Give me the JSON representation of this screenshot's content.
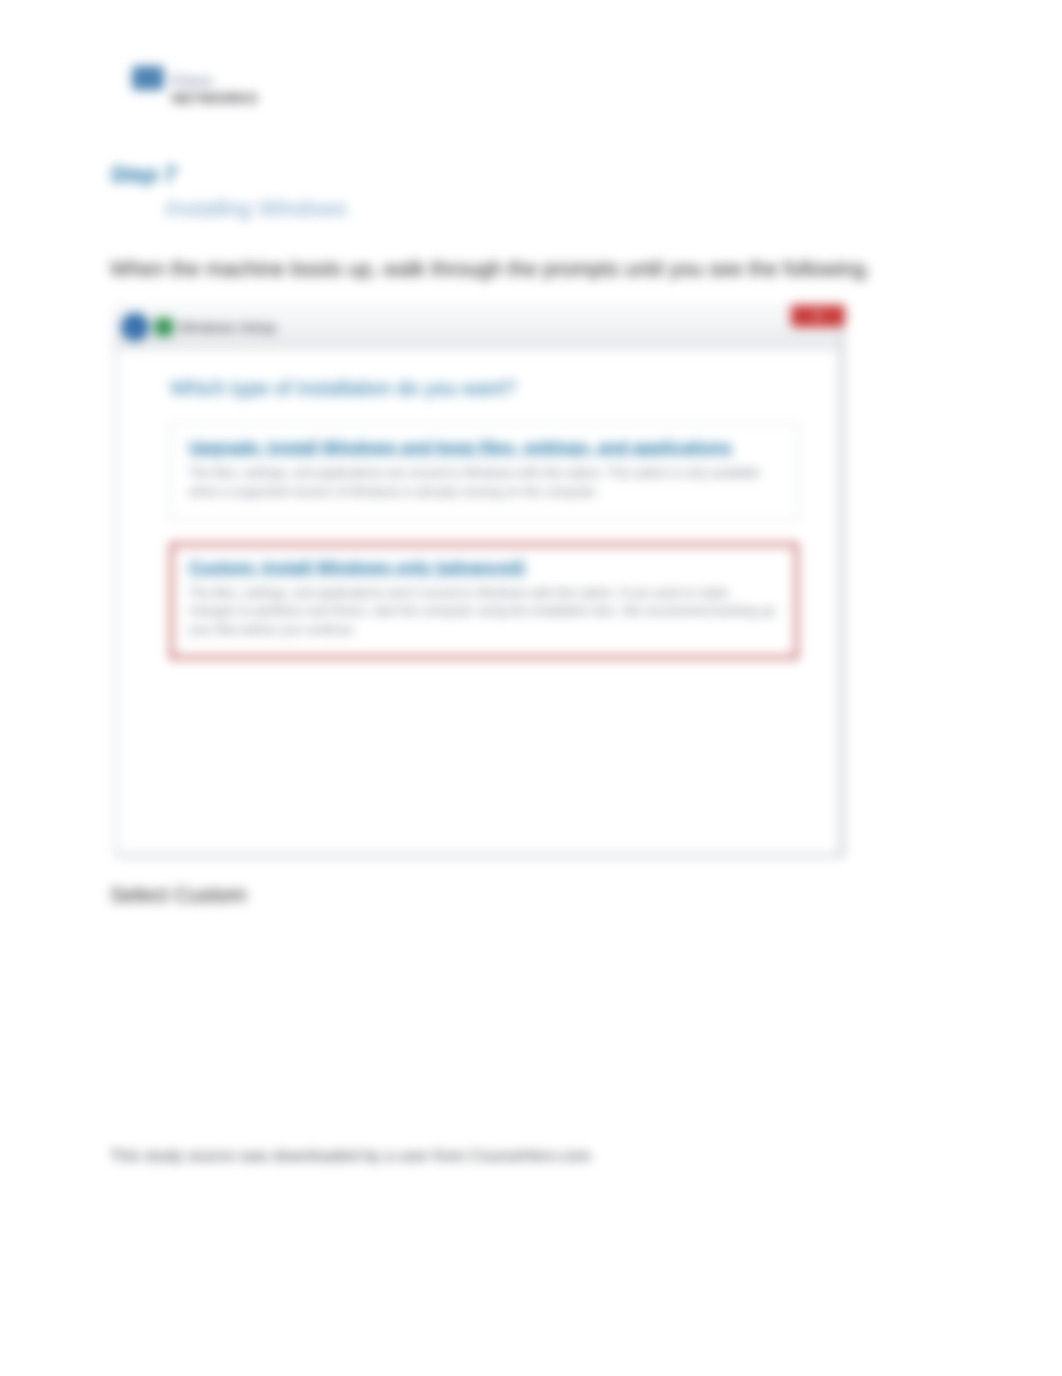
{
  "logo": {
    "top": "Cisco",
    "bottom": "NETWORKS"
  },
  "step": {
    "label": "Step 7",
    "sub": "Installing Windows"
  },
  "intro": "When the machine boots up, walk through the prompts until you see the following.",
  "dialog": {
    "titlebar": {
      "title": "Windows Setup",
      "back_glyph": "←",
      "close_glyph": "✕"
    },
    "heading": "Which type of installation do you want?",
    "option1": {
      "title": "Upgrade: Install Windows and keep files, settings, and applications",
      "desc": "The files, settings, and applications are moved to Windows with this option. This option is only available when a supported version of Windows is already running on the computer."
    },
    "option2": {
      "title": "Custom: Install Windows only (advanced)",
      "desc": "The files, settings, and applications aren't moved to Windows with this option. If you want to make changes to partitions and drives, start the computer using the installation disc. We recommend backing up your files before you continue."
    }
  },
  "post": "Select Custom",
  "footer": "This study source was downloaded by a user from CourseHero.com"
}
